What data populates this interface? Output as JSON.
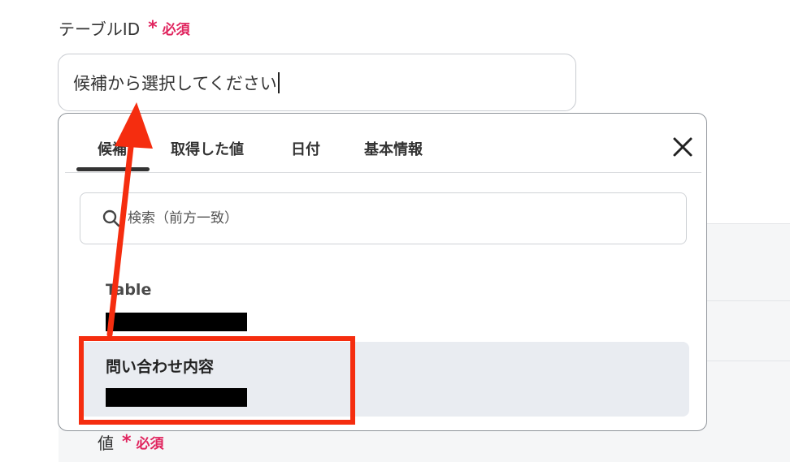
{
  "field": {
    "label": "テーブルID",
    "required_star": "*",
    "required_text": "必須",
    "input_value": "候補から選択してください"
  },
  "dropdown": {
    "tabs": [
      {
        "label": "候補",
        "active": true
      },
      {
        "label": "取得した値",
        "active": false
      },
      {
        "label": "日付",
        "active": false
      },
      {
        "label": "基本情報",
        "active": false
      }
    ],
    "search_placeholder": "検索（前方一致）",
    "options": [
      {
        "title": "Table",
        "subtitle_redacted": true,
        "selected": false
      },
      {
        "title": "問い合わせ内容",
        "subtitle_redacted": true,
        "selected": true
      }
    ]
  },
  "value_field": {
    "label": "値",
    "required_star": "*",
    "required_text": "必須"
  },
  "icons": {
    "close": "close-icon",
    "search": "search-icon"
  },
  "colors": {
    "required": "#e0245e",
    "annotation": "#f52d0f",
    "selected_bg": "#e9ecf1"
  }
}
